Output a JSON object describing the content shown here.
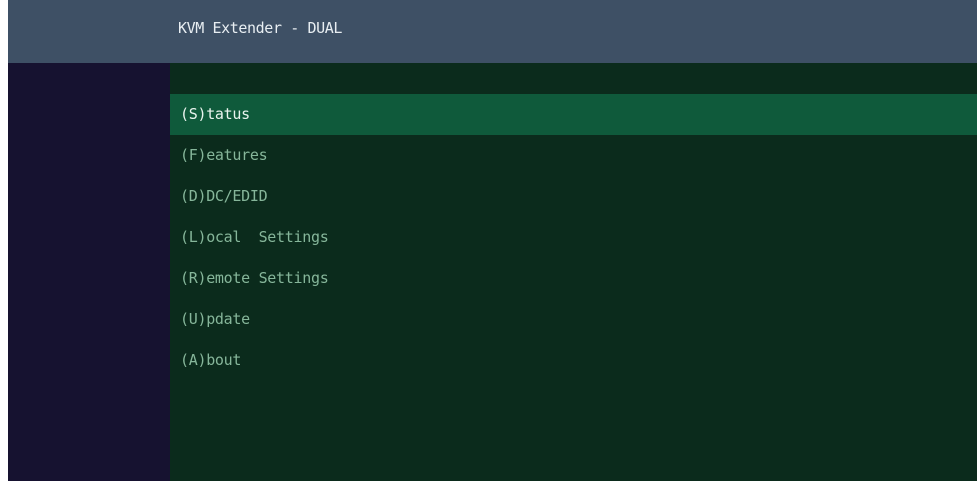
{
  "window": {
    "title": "KVM Extender - DUAL"
  },
  "menu": {
    "selected_index": 0,
    "items": [
      {
        "label": "(S)tatus"
      },
      {
        "label": "(F)eatures"
      },
      {
        "label": "(D)DC/EDID"
      },
      {
        "label": "(L)ocal  Settings"
      },
      {
        "label": "(R)emote Settings"
      },
      {
        "label": "(U)pdate"
      },
      {
        "label": "(A)bout"
      }
    ]
  },
  "colors": {
    "header_bg": "#3e5065",
    "sidebar_bg": "#161230",
    "main_bg": "#0b2b1c",
    "selected_bg": "#0f5a3b",
    "menu_text": "#86b69a",
    "selected_text": "#e9f4ee"
  }
}
